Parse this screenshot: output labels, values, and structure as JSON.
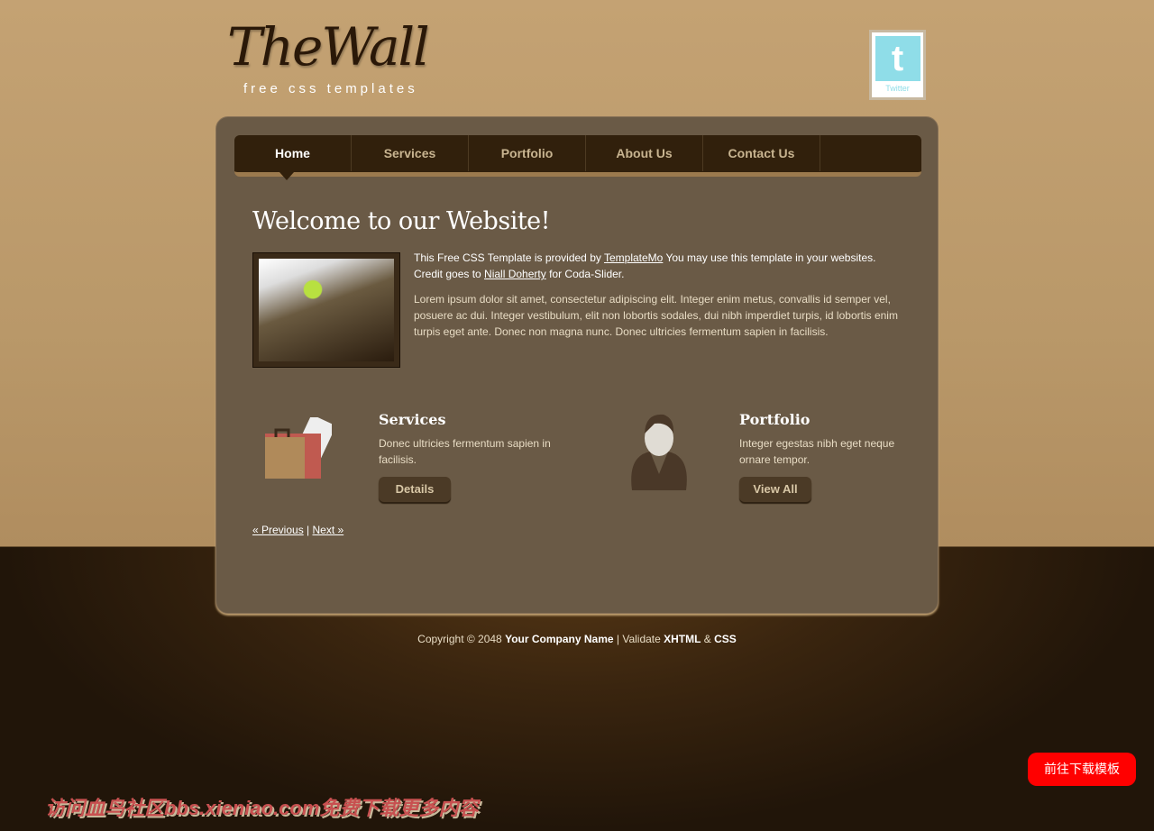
{
  "logo": {
    "title": "TheWall",
    "subtitle": "free css templates"
  },
  "twitter": {
    "label": "Twitter"
  },
  "nav": [
    {
      "label": "Home",
      "active": true
    },
    {
      "label": "Services"
    },
    {
      "label": "Portfolio"
    },
    {
      "label": "About Us"
    },
    {
      "label": "Contact Us"
    }
  ],
  "main": {
    "title": "Welcome to our Website!",
    "intro": {
      "p1": "This Free CSS Template is provided by ",
      "link1": "TemplateMo",
      "p2": " You may use this template in your websites. Credit goes to ",
      "link2": "Niall Doherty",
      "p3": " for Coda-Slider."
    },
    "lorem": "Lorem ipsum dolor sit amet, consectetur adipiscing elit. Integer enim metus, convallis id semper vel, posuere ac dui. Integer vestibulum, elit non lobortis sodales, dui nibh imperdiet turpis, id lobortis enim turpis eget ante. Donec non magna nunc. Donec ultricies fermentum sapien in facilisis."
  },
  "services": {
    "title": "Services",
    "text": "Donec ultricies fermentum sapien in facilisis.",
    "button": "Details"
  },
  "portfolio": {
    "title": "Portfolio",
    "text": "Integer egestas nibh eget neque ornare tempor.",
    "button": "View All"
  },
  "pager": {
    "prev": "« Previous",
    "sep": " | ",
    "next": "Next »"
  },
  "footer": {
    "copy": "Copyright © 2048 ",
    "company": "Your Company Name",
    "sep": " | Validate ",
    "xhtml": "XHTML",
    "amp": " & ",
    "css": "CSS"
  },
  "watermark": "访问血鸟社区bbs.xieniao.com免费下载更多内容",
  "download_button": "前往下载模板"
}
